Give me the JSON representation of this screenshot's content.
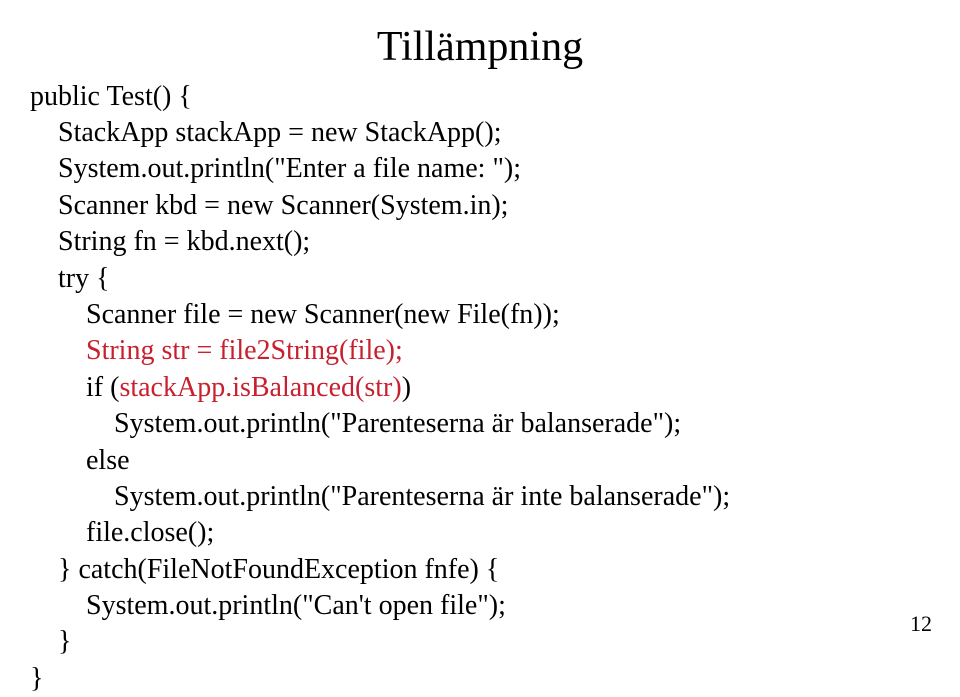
{
  "title": "Tillämpning",
  "code": {
    "l1": "public Test() {",
    "l2": "    StackApp stackApp = new StackApp();",
    "l3": "    System.out.println(\"Enter a file name: \");",
    "l4": "    Scanner kbd = new Scanner(System.in);",
    "l5": "    String fn = kbd.next();",
    "l6": "    try {",
    "l7": "        Scanner file = new Scanner(new File(fn));",
    "l8r": "        String str = file2String(file);",
    "l9a": "        if (",
    "l9r": "stackApp.isBalanced(str)",
    "l9b": ")",
    "l10": "            System.out.println(\"Parenteserna är balanserade\");",
    "l11": "        else",
    "l12": "            System.out.println(\"Parenteserna är inte balanserade\");",
    "l13": "        file.close();",
    "l14": "    } catch(FileNotFoundException fnfe) {",
    "l15": "        System.out.println(\"Can't open file\");",
    "l16": "    }",
    "l17": "}"
  },
  "page_number": "12"
}
